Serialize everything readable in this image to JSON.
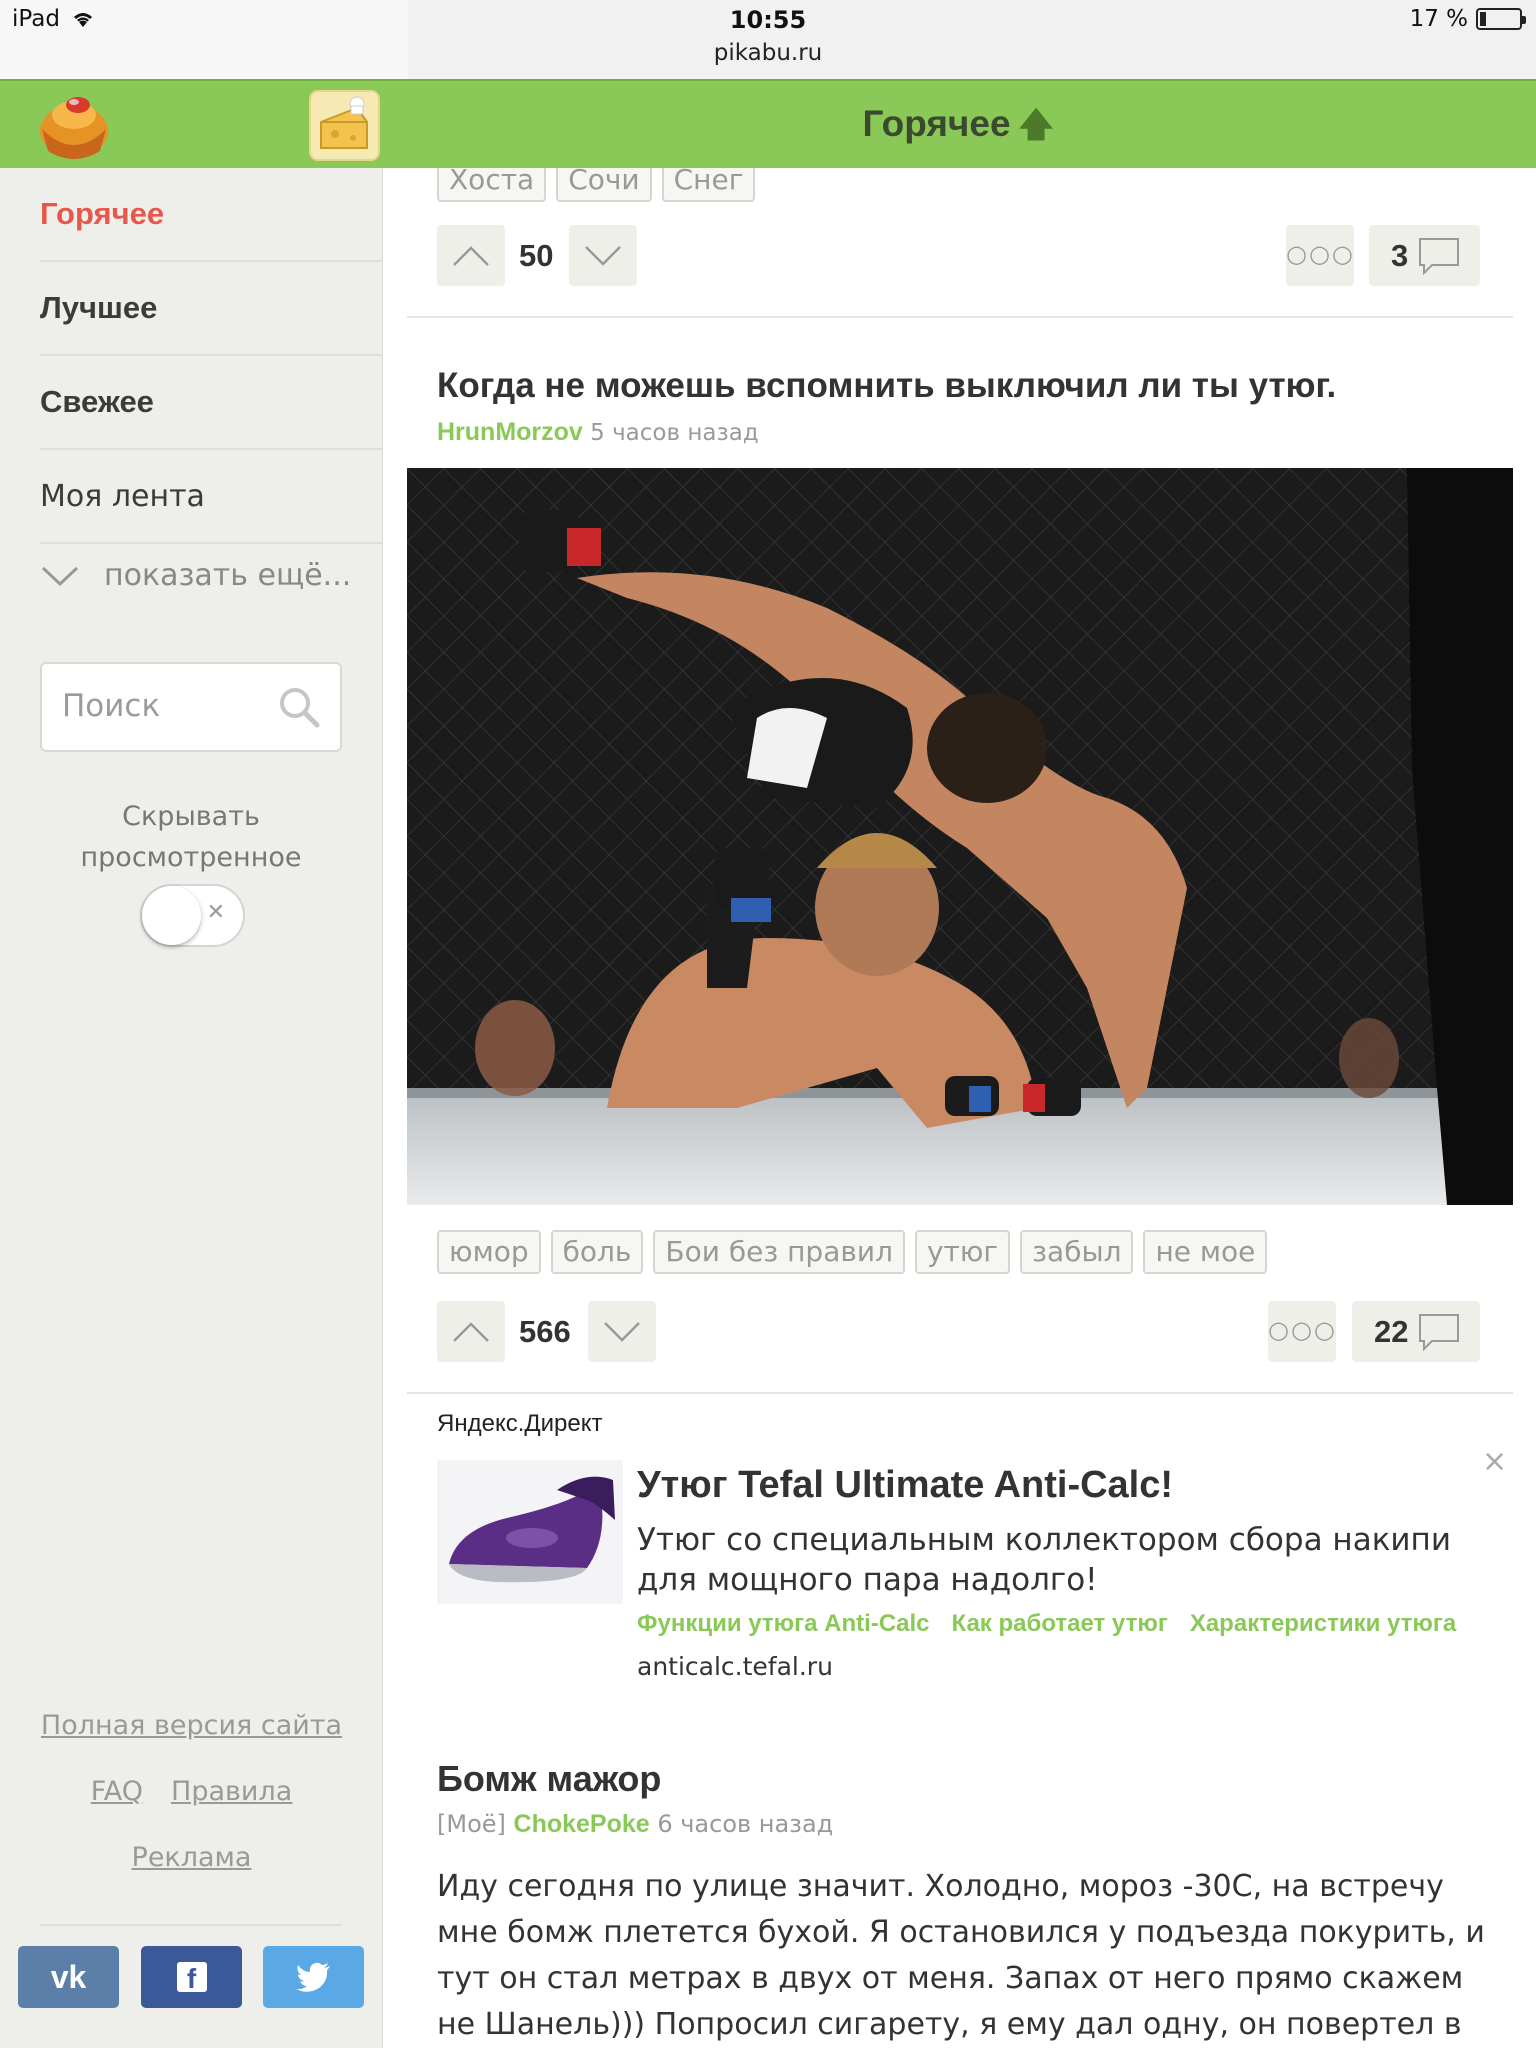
{
  "status_bar": {
    "device": "iPad",
    "time": "10:55",
    "url": "pikabu.ru",
    "battery": "17 %"
  },
  "header": {
    "title": "Горячее",
    "arrow_icon": "arrow-up-icon",
    "brand_color": "#8ac858"
  },
  "sidebar": {
    "nav": [
      {
        "label": "Горячее",
        "active": true
      },
      {
        "label": "Лучшее"
      },
      {
        "label": "Свежее"
      },
      {
        "label": "Моя лента"
      }
    ],
    "show_more": "показать ещё...",
    "search_placeholder": "Поиск",
    "hide_viewed_line1": "Скрывать",
    "hide_viewed_line2": "просмотренное",
    "toggle_on": false,
    "full_version": "Полная версия сайта",
    "faq": "FAQ",
    "rules": "Правила",
    "ads": "Реклама",
    "social": [
      "vk",
      "facebook",
      "twitter"
    ]
  },
  "prev_post": {
    "tags": [
      "Хоста",
      "Сочи",
      "Снег"
    ],
    "score": "50",
    "comments": "3"
  },
  "post": {
    "title": "Когда не можешь вспомнить выключил ли ты утюг.",
    "author": "HrunMorzov",
    "time": "5 часов назад",
    "tags": [
      "юмор",
      "боль",
      "Бои без правил",
      "утюг",
      "забыл",
      "не мое"
    ],
    "score": "566",
    "comments": "22"
  },
  "ad": {
    "label": "Яндекс.Директ",
    "close": "×",
    "title": "Утюг Tefal Ultimate Anti-Calc!",
    "text": "Утюг со специальным коллектором сбора накипи для мощного пара надолго!",
    "links": [
      "Функции утюга Anti-Calc",
      "Как работает утюг",
      "Характеристики утюга"
    ],
    "domain": "anticalc.tefal.ru"
  },
  "post2": {
    "title": "Бомж мажор",
    "prefix": "[Моё]",
    "author": "ChokePoke",
    "time": "6 часов назад",
    "body": "Иду сегодня по улице значит. Холодно, мороз -30С, на встречу мне бомж плетется бухой. Я остановился у подъезда покурить, и тут он стал метрах в двух от меня. Запах от него прямо скажем не Шанель))) Попросил сигарету, я ему дал одну, он повертел в руках, осмотрел,"
  }
}
